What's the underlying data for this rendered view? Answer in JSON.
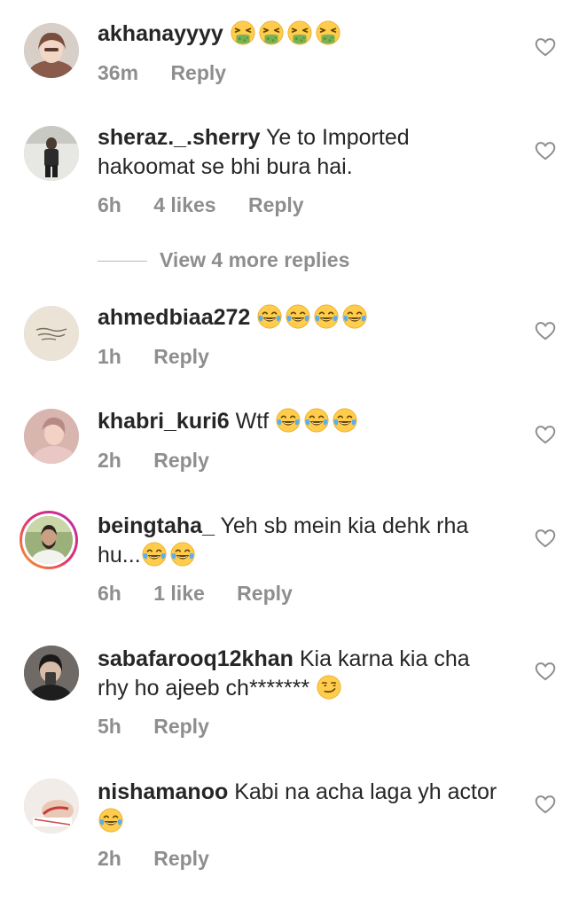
{
  "comments": [
    {
      "username": "akhanayyyy",
      "text": "",
      "emojis": [
        "nauseated",
        "nauseated",
        "nauseated",
        "nauseated"
      ],
      "time": "36m",
      "likes": "",
      "reply": "Reply"
    },
    {
      "username": "sheraz._.sherry",
      "text": "Ye to Imported hakoomat se bhi bura hai.",
      "emojis": [],
      "time": "6h",
      "likes": "4 likes",
      "reply": "Reply"
    },
    {
      "username": "ahmedbiaa272",
      "text": "",
      "emojis": [
        "joy",
        "joy",
        "joy",
        "joy"
      ],
      "time": "1h",
      "likes": "",
      "reply": "Reply"
    },
    {
      "username": "khabri_kuri6",
      "text": "Wtf",
      "emojis": [
        "joy",
        "joy",
        "joy"
      ],
      "time": "2h",
      "likes": "",
      "reply": "Reply"
    },
    {
      "username": "beingtaha_",
      "text": "Yeh sb mein kia dehk rha hu...",
      "emojis": [
        "joy",
        "joy"
      ],
      "time": "6h",
      "likes": "1 like",
      "reply": "Reply"
    },
    {
      "username": "sabafarooq12khan",
      "text": "Kia karna  kia cha rhy ho ajeeb ch*******",
      "emojis": [
        "smirk"
      ],
      "time": "5h",
      "likes": "",
      "reply": "Reply"
    },
    {
      "username": "nishamanoo",
      "text": "Kabi na acha laga yh actor",
      "emojis": [
        "joy"
      ],
      "time": "2h",
      "likes": "",
      "reply": "Reply"
    }
  ],
  "view_replies_label": "View 4 more replies",
  "icons": {
    "like": "heart-outline-icon"
  },
  "colors": {
    "text": "#262626",
    "secondary": "#8e8e8e",
    "story_ring_start": "#f9a12a",
    "story_ring_end": "#b52fb0"
  }
}
